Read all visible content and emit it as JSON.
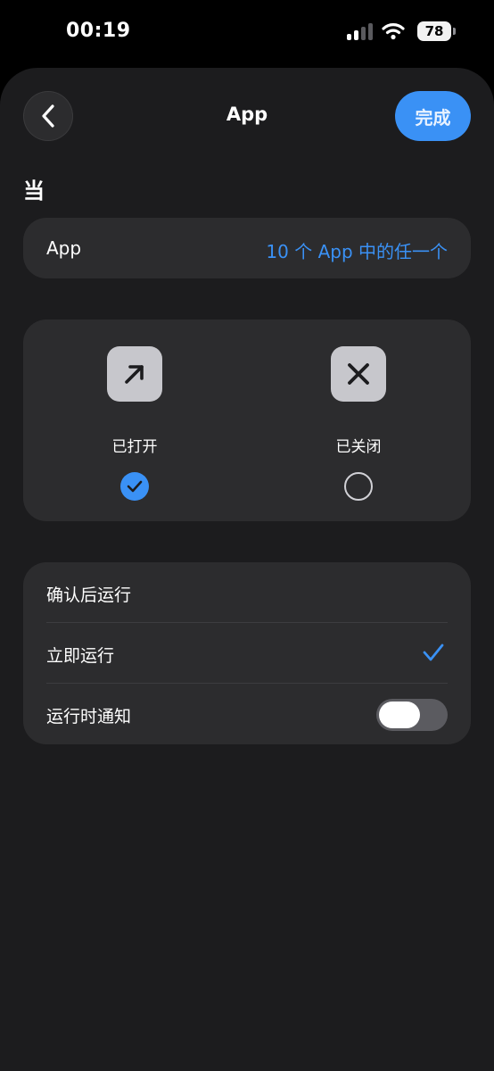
{
  "status_bar": {
    "time": "00:19",
    "battery": "78"
  },
  "nav": {
    "title": "App",
    "done_label": "完成"
  },
  "trigger": {
    "section_title": "当",
    "app_label": "App",
    "app_value": "10 个 App 中的任一个"
  },
  "state": {
    "options": [
      {
        "label": "已打开",
        "icon": "arrow-up-right-icon",
        "selected": true
      },
      {
        "label": "已关闭",
        "icon": "x-mark-icon",
        "selected": false
      }
    ]
  },
  "run_options": {
    "items": [
      {
        "label": "确认后运行",
        "checked": false
      },
      {
        "label": "立即运行",
        "checked": true
      }
    ],
    "notify_label": "运行时通知",
    "notify_on": false
  },
  "colors": {
    "accent": "#3a91f5",
    "sheet_bg": "#1c1c1e",
    "card_bg": "#2c2c2e"
  }
}
